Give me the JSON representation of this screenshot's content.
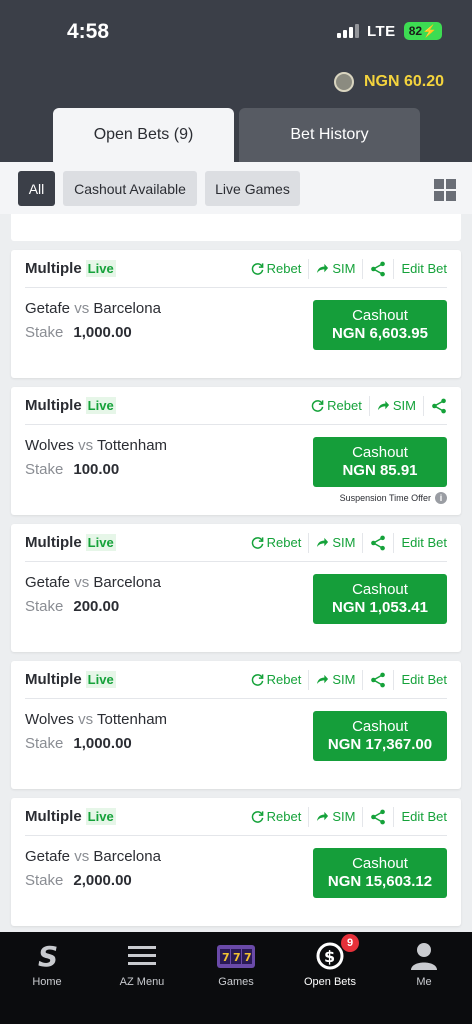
{
  "status": {
    "time": "4:58",
    "network": "LTE",
    "battery": "82"
  },
  "account": {
    "balance": "NGN 60.20"
  },
  "tabs": [
    {
      "label": "Open Bets (9)"
    },
    {
      "label": "Bet History"
    }
  ],
  "filters": [
    {
      "label": "All"
    },
    {
      "label": "Cashout Available"
    },
    {
      "label": "Live Games"
    }
  ],
  "actions": {
    "rebet": "Rebet",
    "sim": "SIM",
    "edit": "Edit Bet"
  },
  "bets": [
    {
      "title": "Multiple",
      "live": "Live",
      "home": "Getafe",
      "vs": "vs",
      "away": "Barcelona",
      "stake_label": "Stake",
      "stake": "1,000.00",
      "cashout_label": "Cashout",
      "cashout": "NGN 6,603.95",
      "edit": true
    },
    {
      "title": "Multiple",
      "live": "Live",
      "home": "Wolves",
      "vs": "vs",
      "away": "Tottenham",
      "stake_label": "Stake",
      "stake": "100.00",
      "cashout_label": "Cashout",
      "cashout": "NGN 85.91",
      "edit": false,
      "note": "Suspension Time Offer"
    },
    {
      "title": "Multiple",
      "live": "Live",
      "home": "Getafe",
      "vs": "vs",
      "away": "Barcelona",
      "stake_label": "Stake",
      "stake": "200.00",
      "cashout_label": "Cashout",
      "cashout": "NGN 1,053.41",
      "edit": true
    },
    {
      "title": "Multiple",
      "live": "Live",
      "home": "Wolves",
      "vs": "vs",
      "away": "Tottenham",
      "stake_label": "Stake",
      "stake": "1,000.00",
      "cashout_label": "Cashout",
      "cashout": "NGN 17,367.00",
      "edit": true
    },
    {
      "title": "Multiple",
      "live": "Live",
      "home": "Getafe",
      "vs": "vs",
      "away": "Barcelona",
      "stake_label": "Stake",
      "stake": "2,000.00",
      "cashout_label": "Cashout",
      "cashout": "NGN 15,603.12",
      "edit": true
    }
  ],
  "nav": [
    {
      "label": "Home",
      "icon": "sporty-logo-icon"
    },
    {
      "label": "AZ Menu",
      "icon": "hamburger-menu-icon"
    },
    {
      "label": "Games",
      "icon": "slot-machine-icon"
    },
    {
      "label": "Open Bets",
      "icon": "open-bets-icon",
      "badge": "9"
    },
    {
      "label": "Me",
      "icon": "user-icon"
    }
  ],
  "colors": {
    "accent_green": "#159e3a",
    "header": "#3b3f48",
    "balance": "#f4d43d",
    "badge": "#e6313a"
  }
}
